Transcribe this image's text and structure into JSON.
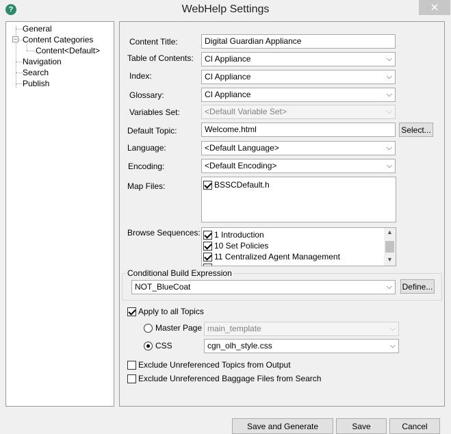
{
  "window": {
    "title": "WebHelp Settings",
    "close_glyph": "✕",
    "icon": "help-globe-icon"
  },
  "tree": {
    "items": [
      {
        "label": "General"
      },
      {
        "label": "Content Categories",
        "expander": "−"
      },
      {
        "label": "Content<Default>",
        "selected": true
      },
      {
        "label": "Navigation"
      },
      {
        "label": "Search"
      },
      {
        "label": "Publish"
      }
    ]
  },
  "form": {
    "content_title": {
      "label": "Content Title:",
      "value": "Digital Guardian Appliance"
    },
    "toc": {
      "label": "Table of Contents:",
      "value": "CI Appliance"
    },
    "index": {
      "label": "Index:",
      "value": "CI Appliance"
    },
    "glossary": {
      "label": "Glossary:",
      "value": "CI Appliance"
    },
    "variables_set": {
      "label": "Variables Set:",
      "value": "<Default Variable Set>"
    },
    "default_topic": {
      "label": "Default Topic:",
      "value": "Welcome.html",
      "button": "Select..."
    },
    "language": {
      "label": "Language:",
      "value": "<Default Language>"
    },
    "encoding": {
      "label": "Encoding:",
      "value": "<Default Encoding>"
    },
    "map_files": {
      "label": "Map Files:",
      "items": [
        {
          "label": "BSSCDefault.h",
          "checked": true
        }
      ]
    },
    "browse_sequences": {
      "label": "Browse Sequences:",
      "items": [
        {
          "label": "1 Introduction",
          "checked": true
        },
        {
          "label": "10 Set Policies",
          "checked": true
        },
        {
          "label": "11 Centralized Agent Management",
          "checked": true
        }
      ]
    },
    "conditional_build": {
      "label": "Conditional Build Expression",
      "value": "NOT_BlueCoat",
      "button": "Define..."
    },
    "apply_all_topics": {
      "label": "Apply to all Topics",
      "checked": true
    },
    "master_page": {
      "label": "Master Page",
      "value": "main_template",
      "selected": false
    },
    "css": {
      "label": "CSS",
      "value": "cgn_olh_style.css",
      "selected": true
    },
    "exclude_topics": {
      "label": "Exclude Unreferenced Topics from Output",
      "checked": false
    },
    "exclude_baggage": {
      "label": "Exclude Unreferenced Baggage Files from Search",
      "checked": false
    }
  },
  "buttons": {
    "save_generate": "Save and Generate",
    "save": "Save",
    "cancel": "Cancel"
  },
  "glyphs": {
    "chevron": "⌵",
    "up": "▲",
    "down": "▼"
  }
}
